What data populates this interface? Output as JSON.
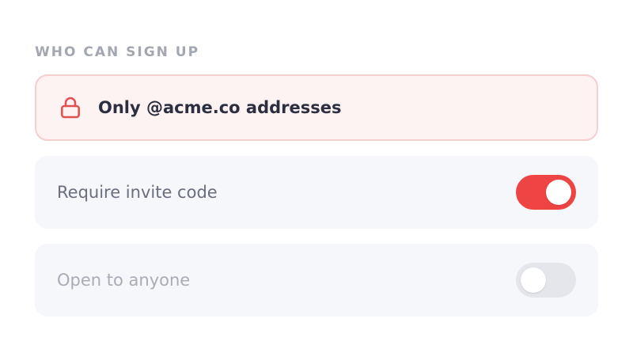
{
  "section": {
    "heading": "WHO CAN SIGN UP"
  },
  "options": [
    {
      "label": "Only @acme.co addresses",
      "icon": "lock-icon",
      "selected": true,
      "accent": "#e05252"
    },
    {
      "label": "Require invite code",
      "toggle_on": true,
      "toggle_color": "#ef4444"
    },
    {
      "label": "Open to anyone",
      "toggle_on": false,
      "toggle_color": "#e4e6ec"
    }
  ]
}
